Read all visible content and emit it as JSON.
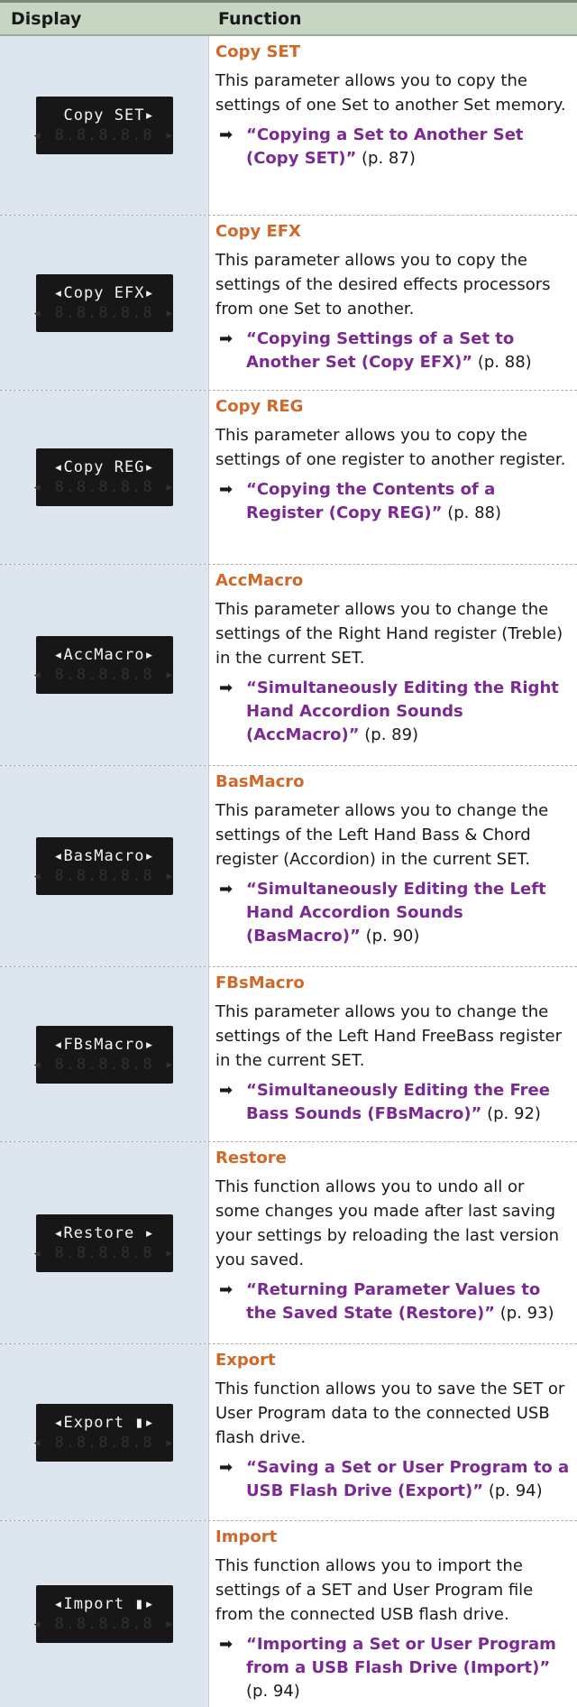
{
  "header": {
    "display": "Display",
    "function": "Function"
  },
  "rows": [
    {
      "lcd_line1": " Copy SET▸",
      "lcd_line2": "◂ 8.8.8.8.8 ▸",
      "title": "Copy SET",
      "desc": "This parameter allows you to copy the settings of one Set to another Set memory.",
      "link": "“Copying a Set to Another Set (Copy SET)”",
      "page": " (p. 87)"
    },
    {
      "lcd_line1": "◂Copy EFX▸",
      "lcd_line2": "◂ 8.8.8.8.8 ▸",
      "title": "Copy EFX",
      "desc": "This parameter allows you to copy the settings of the desired effects processors from one Set to another.",
      "link": "“Copying Settings of a Set to Another Set (Copy EFX)”",
      "page": " (p. 88)"
    },
    {
      "lcd_line1": "◂Copy REG▸",
      "lcd_line2": "◂ 8.8.8.8.8 ▸",
      "title": "Copy REG",
      "desc": "This parameter allows you to copy the settings of one register to another register.",
      "link": "“Copying the Contents of a Register (Copy REG)”",
      "page": " (p. 88)"
    },
    {
      "lcd_line1": "◂AccMacro▸",
      "lcd_line2": "◂ 8.8.8.8.8 ▸",
      "title": "AccMacro",
      "desc": "This parameter allows you to change the settings of the Right Hand register (Treble) in the current SET.",
      "link": "“Simultaneously Editing the Right Hand Accordion Sounds (AccMacro)”",
      "page": " (p. 89)"
    },
    {
      "lcd_line1": "◂BasMacro▸",
      "lcd_line2": "◂ 8.8.8.8.8 ▸",
      "title": "BasMacro",
      "desc": "This parameter allows you to change the settings of the Left Hand Bass & Chord register (Accordion) in the current SET.",
      "link": "“Simultaneously Editing the Left Hand Accordion Sounds (BasMacro)”",
      "page": " (p. 90)"
    },
    {
      "lcd_line1": "◂FBsMacro▸",
      "lcd_line2": "◂ 8.8.8.8.8 ▸",
      "title": "FBsMacro",
      "desc": "This parameter allows you to change the settings of the Left Hand FreeBass register in the current SET.",
      "link": "“Simultaneously Editing the Free Bass Sounds (FBsMacro)”",
      "page": " (p. 92)"
    },
    {
      "lcd_line1": "◂Restore ▸",
      "lcd_line2": "◂ 8.8.8.8.8 ▸",
      "title": "Restore",
      "desc": "This function allows you to undo all or some changes you made after last saving your settings by reloading the last version you saved.",
      "link": "“Returning Parameter Values to the Saved State (Restore)”",
      "page": " (p. 93)"
    },
    {
      "lcd_line1": "◂Export ▮▸",
      "lcd_line2": "◂ 8.8.8.8.8 ▸",
      "title": "Export",
      "desc": "This function allows you to save the SET or User Program data to the connected USB flash drive.",
      "link": "“Saving a Set or User Program to a USB Flash Drive (Export)”",
      "page": " (p. 94)"
    },
    {
      "lcd_line1": "◂Import ▮▸",
      "lcd_line2": "◂ 8.8.8.8.8 ▸",
      "title": "Import",
      "desc": "This function allows you to import the settings of a SET and User Program file from the connected USB flash drive.",
      "link": "“Importing a Set or User Program from a USB Flash Drive (Import)”",
      "page": " (p. 94)"
    }
  ]
}
